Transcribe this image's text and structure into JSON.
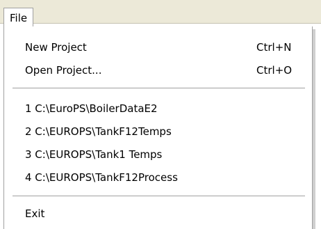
{
  "menubar": {
    "file_label": "File"
  },
  "menu": {
    "items": [
      {
        "label": "New Project",
        "shortcut": "Ctrl+N"
      },
      {
        "label": "Open Project...",
        "shortcut": "Ctrl+O"
      }
    ],
    "recent": [
      "1 C:\\EuroPS\\BoilerDataE2",
      "2 C:\\EUROPS\\TankF12Temps",
      "3 C:\\EUROPS\\Tank1 Temps",
      "4 C:\\EUROPS\\TankF12Process"
    ],
    "exit_label": "Exit"
  }
}
